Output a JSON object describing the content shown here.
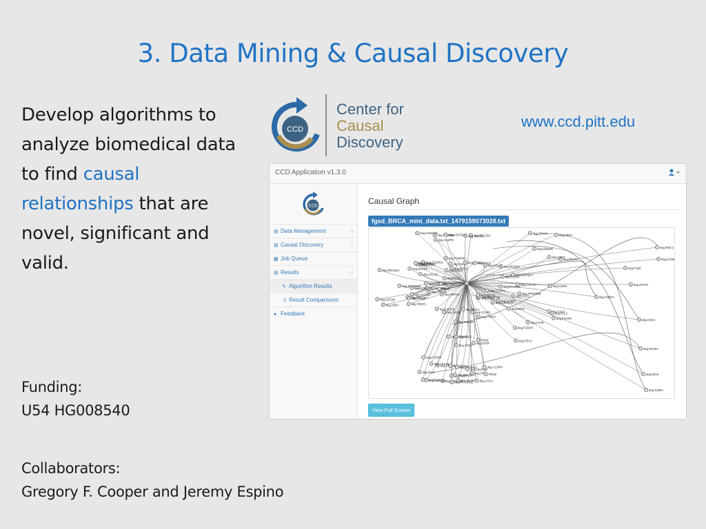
{
  "slide": {
    "title": "3. Data Mining & Causal Discovery",
    "body_part1": "Develop algorithms to analyze biomedical data to find ",
    "body_highlight": "causal relationships",
    "body_part2": " that are novel, significant and valid.",
    "funding_label": "Funding:",
    "funding_grant": "U54 HG008540",
    "collaborators_label": "Collaborators:",
    "collaborators_names": "Gregory F. Cooper and Jeremy Espino",
    "url": "www.ccd.pitt.edu"
  },
  "logo": {
    "initials": "CCD",
    "line1": "Center for",
    "line2": "Causal",
    "line3": "Discovery",
    "colors": {
      "navy": "#3d6384",
      "gold": "#a88e4f",
      "arrow": "#2b6aa6"
    }
  },
  "app": {
    "title": "CCD Application v1.3.0",
    "user_icon": "user-icon",
    "logo_initials": "CCD",
    "sidebar": [
      {
        "label": "Data Management",
        "icon": "database-icon",
        "glyph": "▤",
        "chevron": "‹",
        "sub": false,
        "active": false
      },
      {
        "label": "Causal Discovery",
        "icon": "list-icon",
        "glyph": "▤",
        "chevron": "‹",
        "sub": false,
        "active": false
      },
      {
        "label": "Job Queue",
        "icon": "calendar-icon",
        "glyph": "▦",
        "chevron": "",
        "sub": false,
        "active": false
      },
      {
        "label": "Results",
        "icon": "list-icon",
        "glyph": "▤",
        "chevron": "‹",
        "sub": false,
        "active": false
      },
      {
        "label": "Algorithm Results",
        "icon": "edit-icon",
        "glyph": "✎",
        "chevron": "",
        "sub": true,
        "active": true
      },
      {
        "label": "Result Comparisons",
        "icon": "shuffle-icon",
        "glyph": "⤨",
        "chevron": "",
        "sub": true,
        "active": false
      },
      {
        "label": "Feedback",
        "icon": "comment-icon",
        "glyph": "●",
        "chevron": "",
        "sub": false,
        "active": false
      }
    ],
    "main_title": "Causal Graph",
    "file_name": "fgsd_BRCA_mini_data.txt_1479159073028.txt",
    "full_screen_button": "View Full Screen",
    "accent_color": "#337ab7",
    "graph_labels": [
      "deg.PPP2R5E",
      "deg.CLSPN",
      "deg.RECQL4",
      "deg.COL4",
      "deg.CBX7",
      "deg.GSDMC",
      "deg.ROC1",
      "deg.CCNE2",
      "deg.FHL5",
      "deg.ZFHX4",
      "deg.CD34",
      "deg.PEAR1",
      "deg.EZH1",
      "deg.S100A",
      "deg.TNNT1",
      "deg.FAM65B",
      "deg.CRY2",
      "deg.CSF1R",
      "deg.CCL13",
      "deg.FOXP3",
      "deg.CKS1B",
      "deg.ELL2",
      "deg.STAR",
      "deg.MCM10",
      "deg.DTHFD2",
      "deg.CDC25A",
      "deg.C9orf129",
      "PM1E"
    ]
  }
}
